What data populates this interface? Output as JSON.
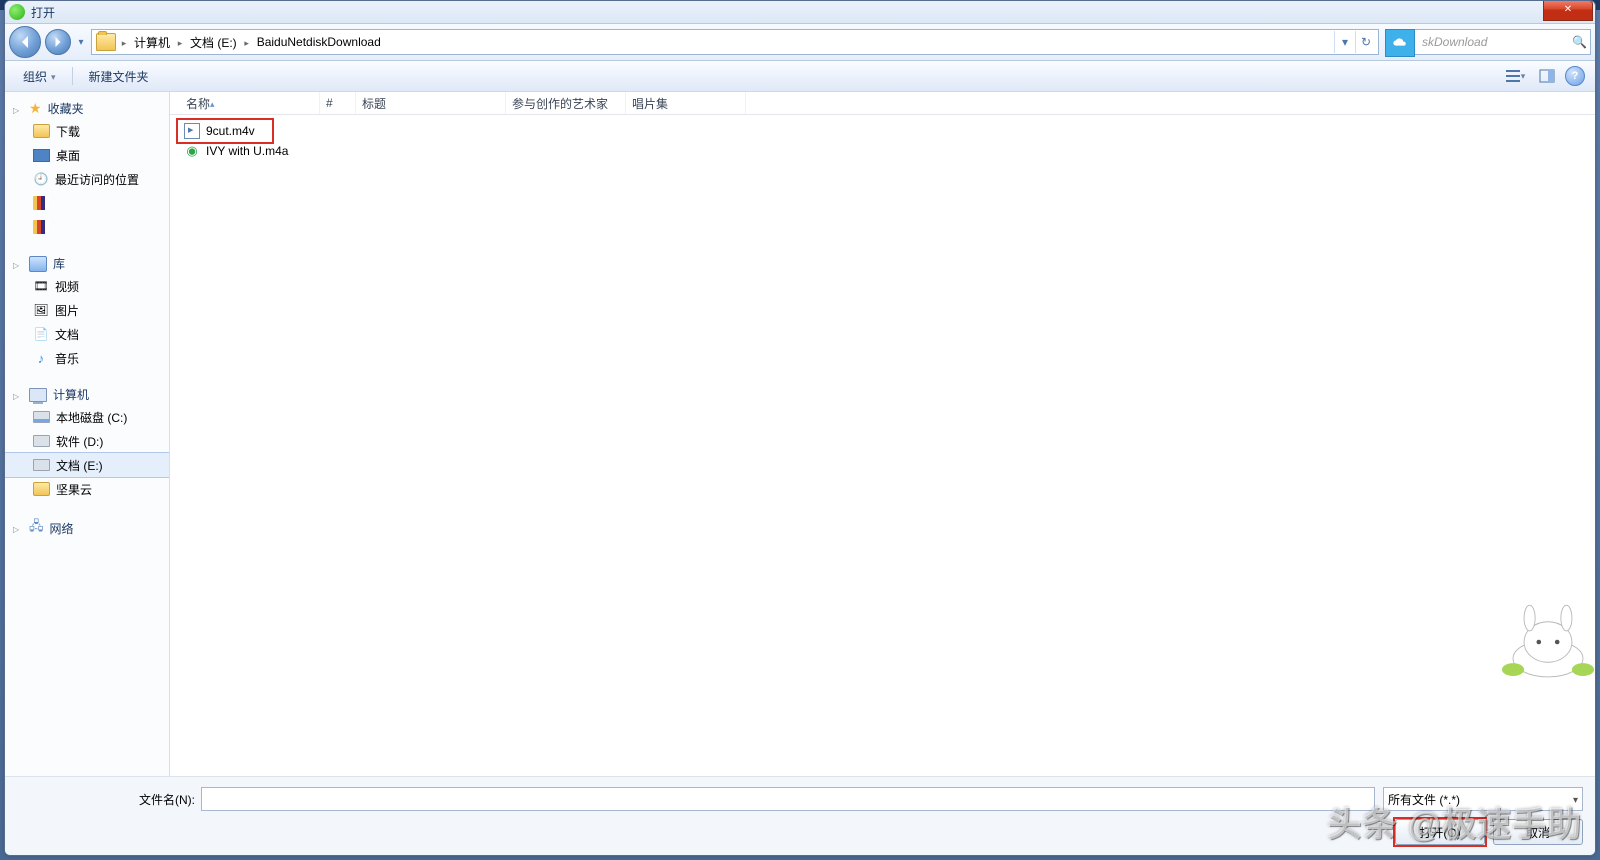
{
  "titlebar": {
    "label": "打开"
  },
  "breadcrumb": {
    "items": [
      "计算机",
      "文档 (E:)",
      "BaiduNetdiskDownload"
    ]
  },
  "search": {
    "placeholder_suffix": "skDownload",
    "magnifier": "🔍"
  },
  "toolbar": {
    "organize": "组织",
    "new_folder": "新建文件夹",
    "help": "?"
  },
  "columns": {
    "name": "名称",
    "number": "#",
    "title": "标题",
    "artists": "参与创作的艺术家",
    "album": "唱片集"
  },
  "files": [
    {
      "name": "9cut.m4v",
      "kind": "video",
      "highlighted": true
    },
    {
      "name": "IVY with U.m4a",
      "kind": "audio",
      "highlighted": false
    }
  ],
  "sidebar": {
    "favorites": {
      "label": "收藏夹",
      "items": [
        {
          "label": "下载",
          "icon": "folder"
        },
        {
          "label": "桌面",
          "icon": "desk"
        },
        {
          "label": "最近访问的位置",
          "icon": "recent"
        }
      ]
    },
    "libraries": {
      "label": "库",
      "items": [
        {
          "label": "视频",
          "icon": "vid"
        },
        {
          "label": "图片",
          "icon": "pic"
        },
        {
          "label": "文档",
          "icon": "doc"
        },
        {
          "label": "音乐",
          "icon": "mus"
        }
      ]
    },
    "computer": {
      "label": "计算机",
      "items": [
        {
          "label": "本地磁盘 (C:)",
          "icon": "drv c"
        },
        {
          "label": "软件 (D:)",
          "icon": "drv"
        },
        {
          "label": "文档 (E:)",
          "icon": "drv",
          "selected": true
        },
        {
          "label": "坚果云",
          "icon": "nut"
        }
      ]
    },
    "network": {
      "label": "网络"
    }
  },
  "footer": {
    "filename_label": "文件名(N):",
    "filename_value": "",
    "filetype": "所有文件 (*.*)",
    "open": "打开(O)",
    "cancel": "取消"
  },
  "watermark": "头条 @极速手助"
}
